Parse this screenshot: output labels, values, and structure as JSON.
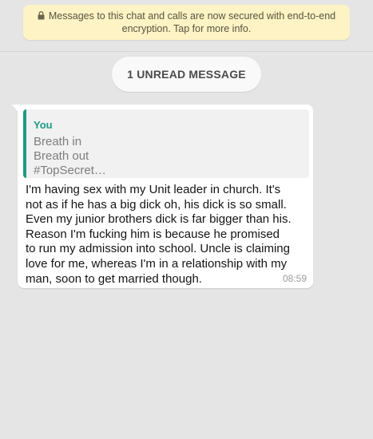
{
  "encryption_banner": {
    "icon": "lock-icon",
    "line1": "Messages to this chat and calls are now secured with end-to-end",
    "line2": "encryption. Tap for more info."
  },
  "unread_divider": {
    "label": "1 UNREAD MESSAGE"
  },
  "message": {
    "quoted": {
      "author": "You",
      "lines": [
        "Breath in",
        "Breath out",
        "#TopSecret…"
      ],
      "accent_color": "#1e9a85"
    },
    "text_lines": [
      "I'm having sex with my Unit leader in church. It's",
      "not as if he has a big dick oh, his dick is so small.",
      "Even my junior brothers dick is far bigger than his.",
      "Reason I'm fucking him is because he promised",
      "to run my admission into school. Uncle is claiming",
      "love for me, whereas I'm in a relationship with my",
      "man, soon to get married though."
    ],
    "time": "08:59"
  },
  "colors": {
    "chat_background": "#e5e5e5",
    "banner_background": "#fdf3c4",
    "bubble_background": "#ffffff"
  }
}
